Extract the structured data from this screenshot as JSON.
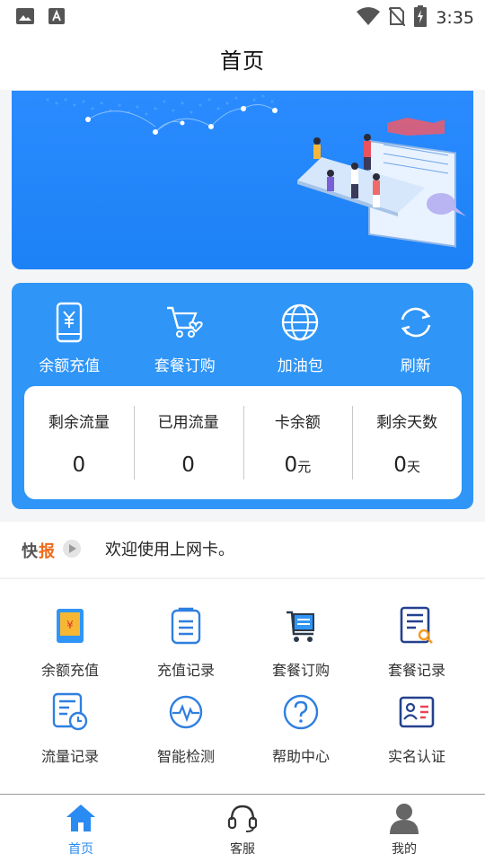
{
  "status_bar": {
    "time": "3:35",
    "icons": [
      "image-icon",
      "font-a-icon",
      "wifi-icon",
      "no-sim-icon",
      "battery-charging-icon"
    ]
  },
  "header": {
    "title": "首页"
  },
  "banner": {
    "slide_count": 2,
    "active_slide": 1
  },
  "quick_actions": [
    {
      "label": "余额充值",
      "icon": "phone-yen-icon"
    },
    {
      "label": "套餐订购",
      "icon": "cart-heart-icon"
    },
    {
      "label": "加油包",
      "icon": "globe-icon"
    },
    {
      "label": "刷新",
      "icon": "refresh-icon"
    }
  ],
  "stats": [
    {
      "label": "剩余流量",
      "value": "0",
      "unit": ""
    },
    {
      "label": "已用流量",
      "value": "0",
      "unit": ""
    },
    {
      "label": "卡余额",
      "value": "0",
      "unit": "元"
    },
    {
      "label": "剩余天数",
      "value": "0",
      "unit": "天"
    }
  ],
  "news": {
    "tag_part1": "快",
    "tag_part2": "报",
    "text": "欢迎使用上网卡。"
  },
  "menu": [
    {
      "label": "余额充值",
      "icon": "recharge-icon"
    },
    {
      "label": "充值记录",
      "icon": "clipboard-icon"
    },
    {
      "label": "套餐订购",
      "icon": "shopping-cart-icon"
    },
    {
      "label": "套餐记录",
      "icon": "document-search-icon"
    },
    {
      "label": "流量记录",
      "icon": "document-clock-icon"
    },
    {
      "label": "智能检测",
      "icon": "pulse-icon"
    },
    {
      "label": "帮助中心",
      "icon": "help-icon"
    },
    {
      "label": "实名认证",
      "icon": "id-card-icon"
    }
  ],
  "tabs": [
    {
      "label": "首页",
      "icon": "home-icon",
      "active": true
    },
    {
      "label": "客服",
      "icon": "headset-icon",
      "active": false
    },
    {
      "label": "我的",
      "icon": "user-icon",
      "active": false
    }
  ],
  "colors": {
    "primary": "#2f95f7",
    "banner": "#2a8bff",
    "accent_orange": "#f06a1a",
    "tab_active": "#2a8bf2"
  }
}
